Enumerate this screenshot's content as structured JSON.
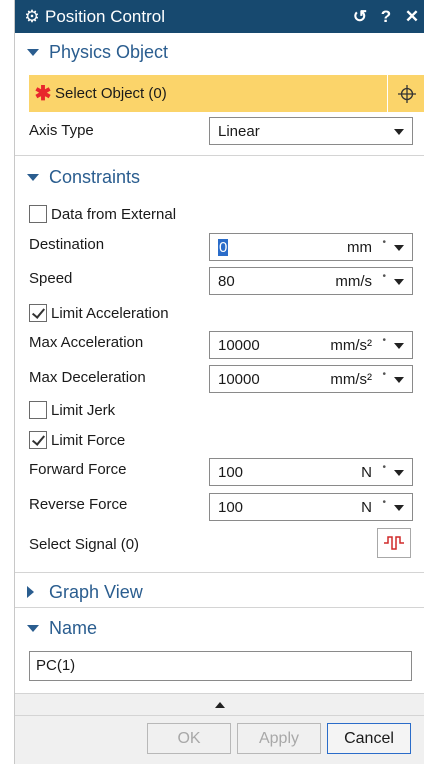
{
  "window": {
    "title": "Position Control",
    "reset_glyph": "↺",
    "help_glyph": "?",
    "close_glyph": "✕",
    "title_icon": "gear-icon"
  },
  "physics_object": {
    "title": "Physics Object",
    "select_label": "Select Object (0)",
    "required_marker": "✱",
    "axis_type_label": "Axis Type",
    "axis_type_value": "Linear"
  },
  "constraints": {
    "title": "Constraints",
    "data_from_external": {
      "label": "Data from External",
      "checked": false
    },
    "destination": {
      "label": "Destination",
      "value": "0",
      "unit": "mm"
    },
    "speed": {
      "label": "Speed",
      "value": "80",
      "unit": "mm/s"
    },
    "limit_acceleration": {
      "label": "Limit Acceleration",
      "checked": true
    },
    "max_acceleration": {
      "label": "Max Acceleration",
      "value": "10000",
      "unit": "mm/s²"
    },
    "max_deceleration": {
      "label": "Max Deceleration",
      "value": "10000",
      "unit": "mm/s²"
    },
    "limit_jerk": {
      "label": "Limit Jerk",
      "checked": false
    },
    "limit_force": {
      "label": "Limit Force",
      "checked": true
    },
    "forward_force": {
      "label": "Forward Force",
      "value": "100",
      "unit": "N"
    },
    "reverse_force": {
      "label": "Reverse Force",
      "value": "100",
      "unit": "N"
    },
    "select_signal_label": "Select Signal (0)"
  },
  "graph_view": {
    "title": "Graph View"
  },
  "name_section": {
    "title": "Name",
    "value": "PC(1)"
  },
  "buttons": {
    "ok": "OK",
    "apply": "Apply",
    "cancel": "Cancel"
  },
  "colors": {
    "titlebar": "#17496f",
    "accent": "#2a5d8f",
    "highlight": "#fbd46a",
    "required": "#e8262c",
    "signal_icon": "#d02a2a"
  }
}
